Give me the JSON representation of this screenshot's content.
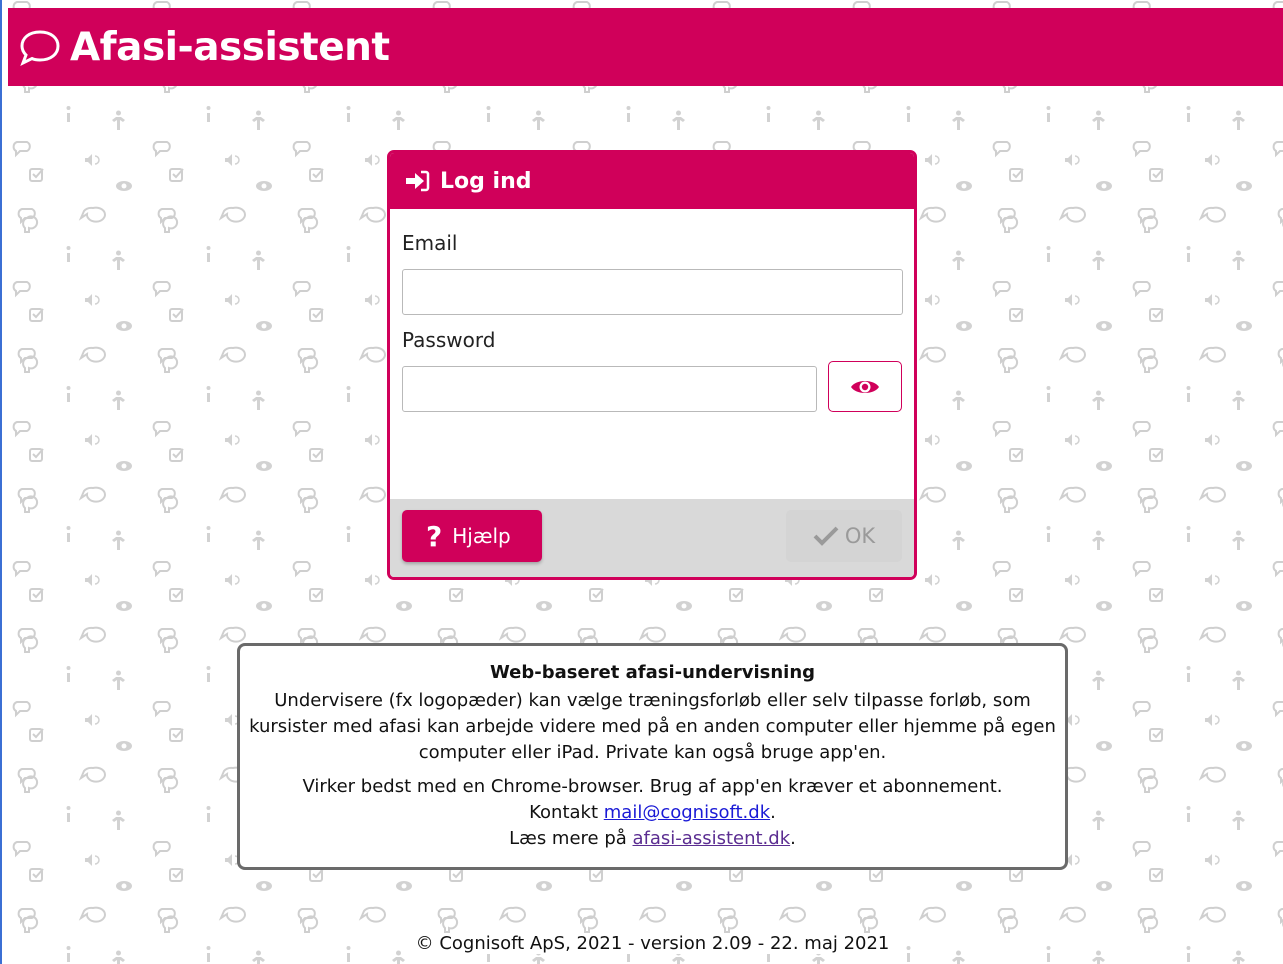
{
  "app": {
    "title": "Afasi-assistent",
    "brand_color": "#d0005a"
  },
  "login": {
    "heading": "Log ind",
    "email_label": "Email",
    "email_value": "",
    "password_label": "Password",
    "password_value": "",
    "show_password_icon": "eye-icon",
    "help_label": "Hjælp",
    "ok_label": "OK"
  },
  "info": {
    "heading": "Web-baseret afasi-undervisning",
    "paragraph1": "Undervisere (fx logopæder) kan vælge træningsforløb eller selv tilpasse forløb, som kursister med afasi kan arbejde videre med på en anden computer eller hjemme på egen computer eller iPad. Private kan også bruge app'en.",
    "paragraph2": "Virker bedst med en Chrome-browser. Brug af app'en kræver et abonnement.",
    "contact_prefix": "Kontakt ",
    "contact_link": "mail@cognisoft.dk",
    "contact_suffix": ".",
    "more_prefix": "Læs mere på ",
    "more_link": "afasi-assistent.dk",
    "more_suffix": "."
  },
  "footer": {
    "text": "© Cognisoft ApS, 2021 - version 2.09 - 22. maj 2021"
  }
}
